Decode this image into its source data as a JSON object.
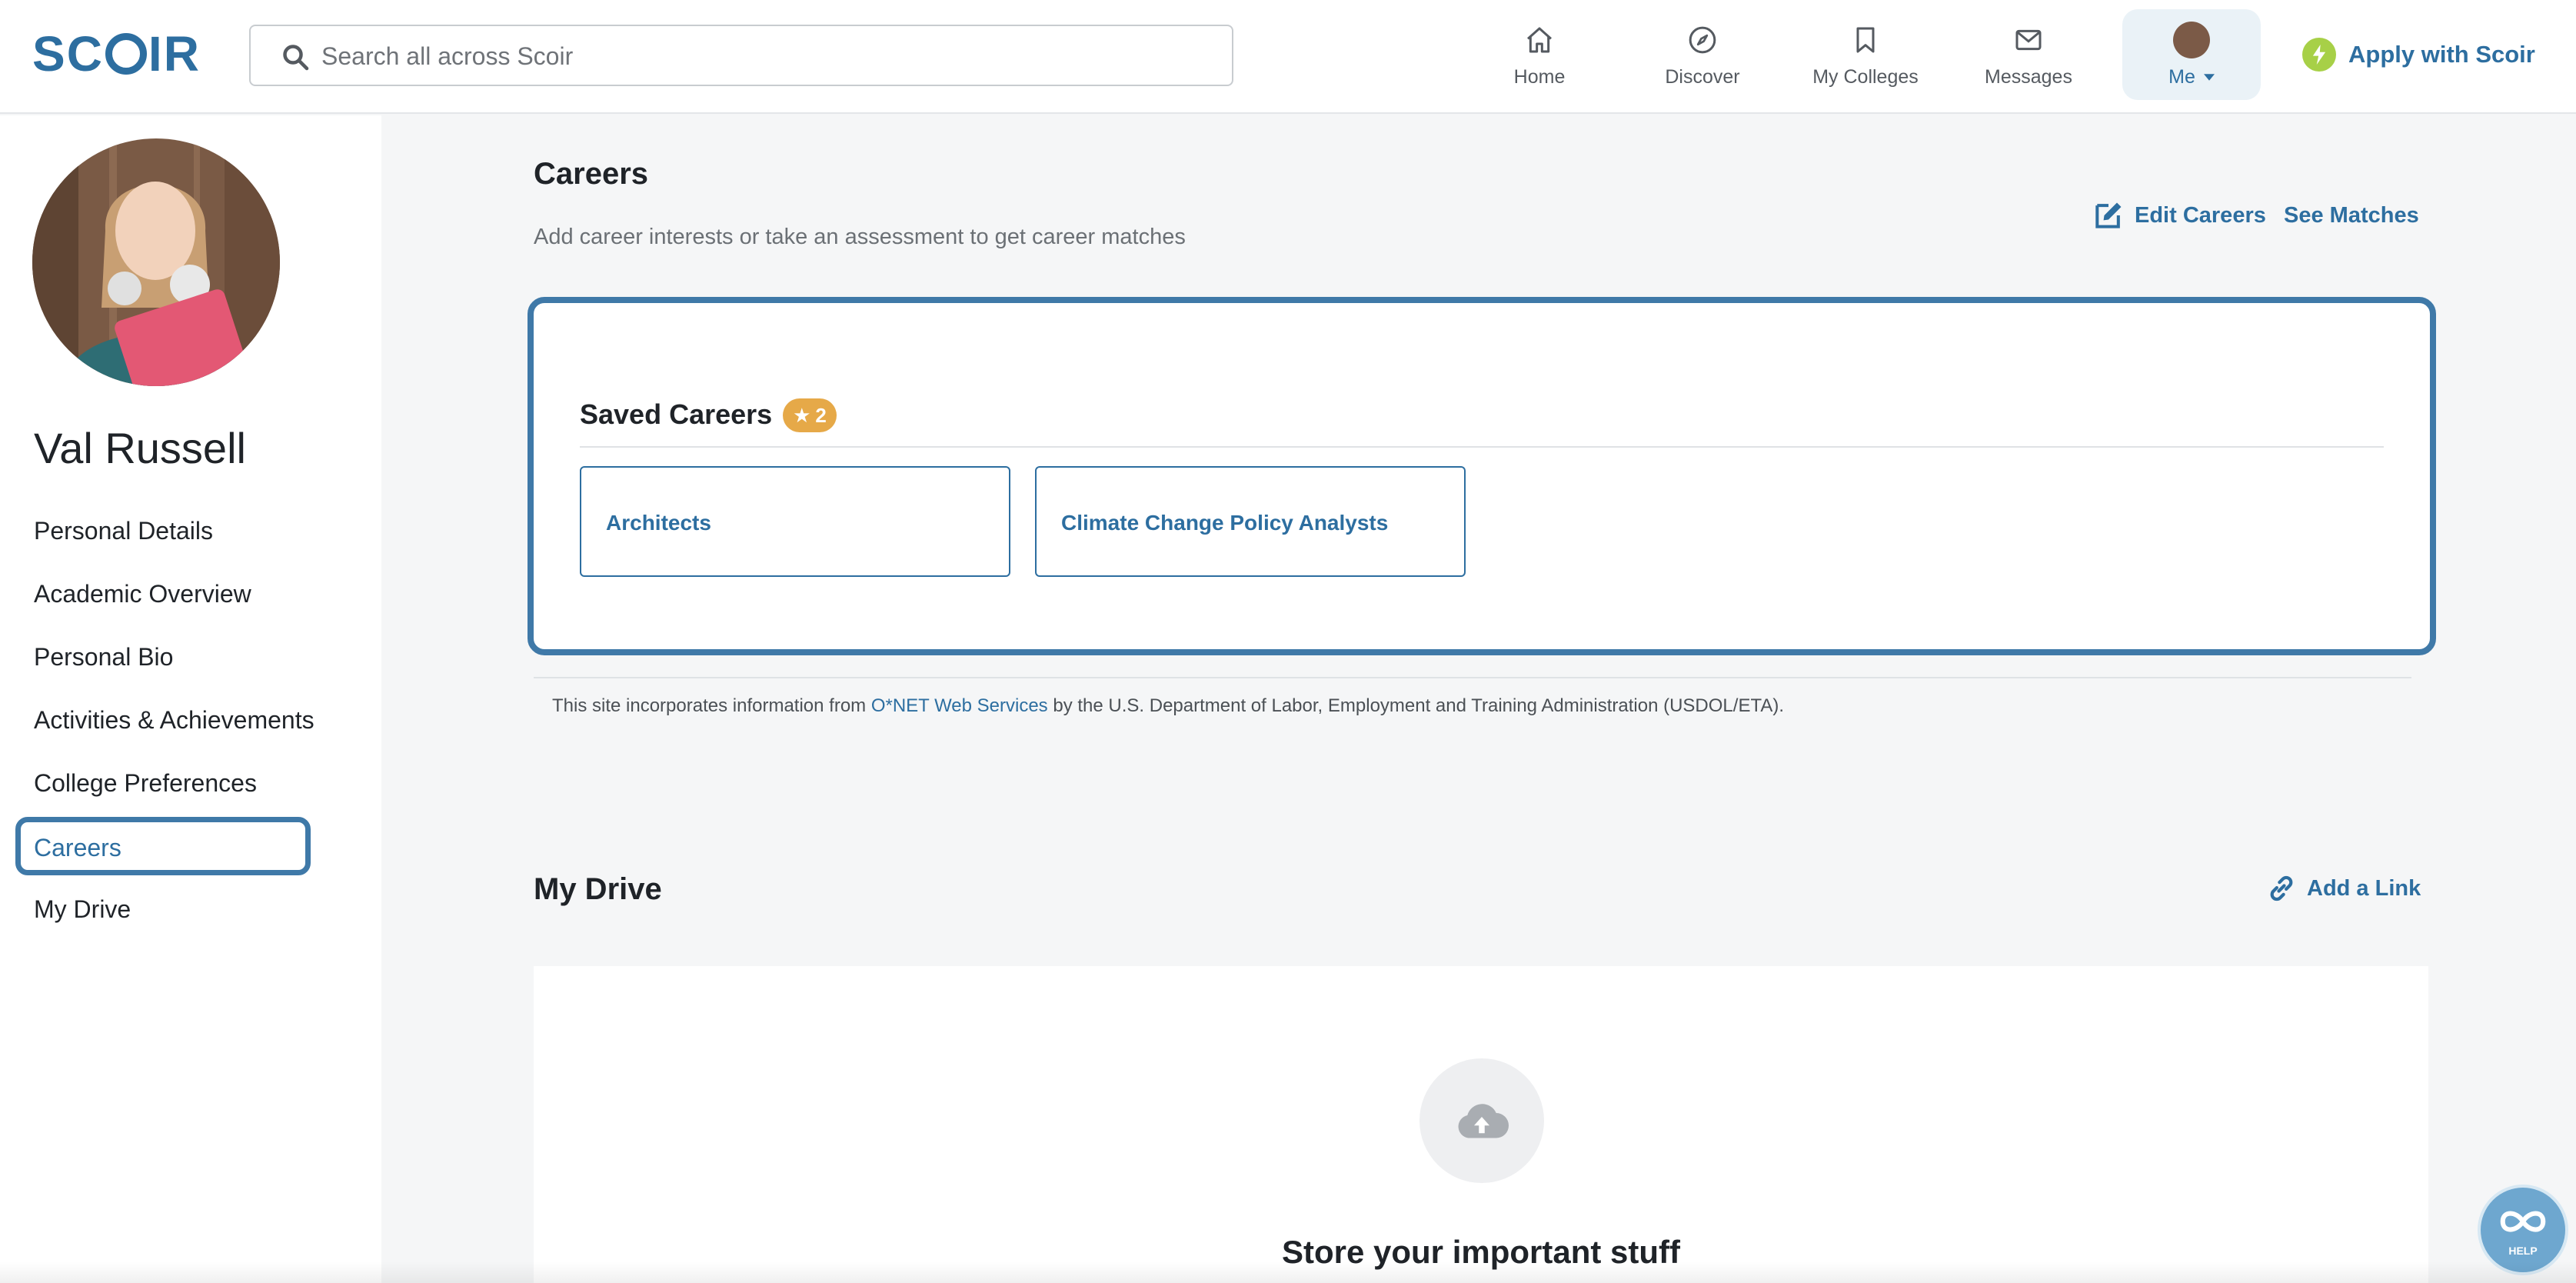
{
  "app": {
    "logo_text": "SCOIR",
    "brand_color": "#2d6ea0"
  },
  "header": {
    "search": {
      "placeholder": "Search all across Scoir",
      "value": ""
    },
    "nav": [
      {
        "label": "Home",
        "icon": "home-icon"
      },
      {
        "label": "Discover",
        "icon": "compass-icon"
      },
      {
        "label": "My Colleges",
        "icon": "bookmark-icon"
      },
      {
        "label": "Messages",
        "icon": "envelope-icon"
      },
      {
        "label": "Me",
        "icon": "avatar",
        "active": true
      }
    ],
    "apply_label": "Apply with Scoir"
  },
  "sidebar": {
    "user_name": "Val Russell",
    "items": [
      {
        "label": "Personal Details"
      },
      {
        "label": "Academic Overview"
      },
      {
        "label": "Personal Bio"
      },
      {
        "label": "Activities & Achievements"
      },
      {
        "label": "College Preferences"
      },
      {
        "label": "Careers",
        "active": true
      },
      {
        "label": "My Drive"
      }
    ]
  },
  "careers": {
    "title": "Careers",
    "subtitle": "Add career interests or take an assessment to get career matches",
    "edit_label": "Edit Careers",
    "matches_label": "See Matches",
    "saved_title": "Saved Careers",
    "saved_count": "2",
    "saved": [
      {
        "name": "Architects"
      },
      {
        "name": "Climate Change Policy Analysts"
      }
    ],
    "attribution_pre": "This site incorporates information from ",
    "attribution_link": "O*NET Web Services",
    "attribution_post": " by the U.S. Department of Labor, Employment and Training Administration (USDOL/ETA)."
  },
  "drive": {
    "title": "My Drive",
    "add_link_label": "Add a Link",
    "empty_title": "Store your important stuff"
  },
  "help": {
    "label": "HELP"
  }
}
